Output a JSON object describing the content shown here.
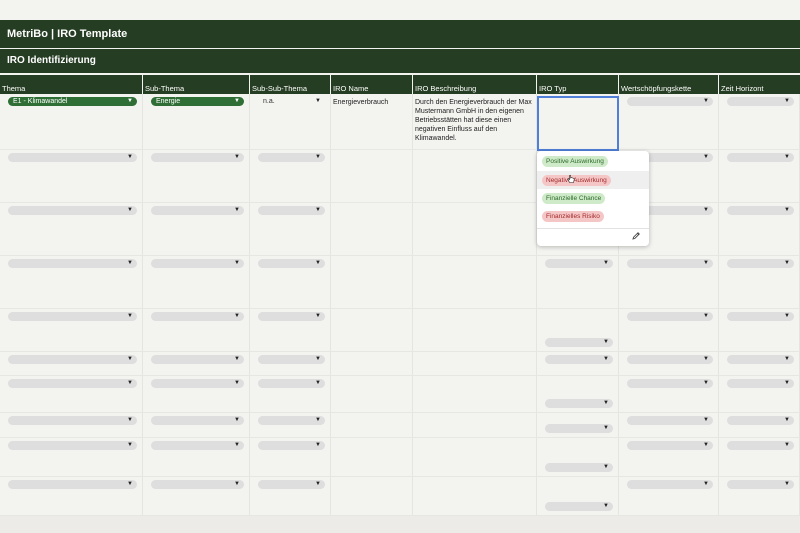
{
  "app_title": "MetriBo | IRO Template",
  "section_title": "IRO Identifizierung",
  "columns": [
    "Thema",
    "Sub-Thema",
    "Sub-Sub-Thema",
    "IRO Name",
    "IRO Beschreibung",
    "IRO Typ",
    "Wertschöpfungskette",
    "Zeit Horizont"
  ],
  "first_row": {
    "thema": "E1 - Klimawandel",
    "sub_thema": "Energie",
    "sub_sub_thema": "n.a.",
    "iro_name": "Energieverbrauch",
    "iro_beschreibung": "Durch den Energieverbrauch der Max Mustermann GmbH in den eigenen Betriebsstätten hat diese einen negativen Einfluss auf den Klimawandel."
  },
  "dropdown": {
    "options": [
      "Positive Auswirkung",
      "Negative Auswirkung",
      "Finanzielle Chance",
      "Finanzielles Risiko"
    ],
    "hovered_index": 1
  },
  "icons": {
    "caret": "chevron-down-icon",
    "edit": "pencil-icon",
    "pointer": "hand-cursor-icon"
  },
  "colors": {
    "header_bg": "#253d22",
    "chip_green": "#2f6e35",
    "chip_empty": "#dedede",
    "active_border": "#4f7fd8",
    "pill_positive": "#cfeac8",
    "pill_negative": "#f5c6c6"
  }
}
